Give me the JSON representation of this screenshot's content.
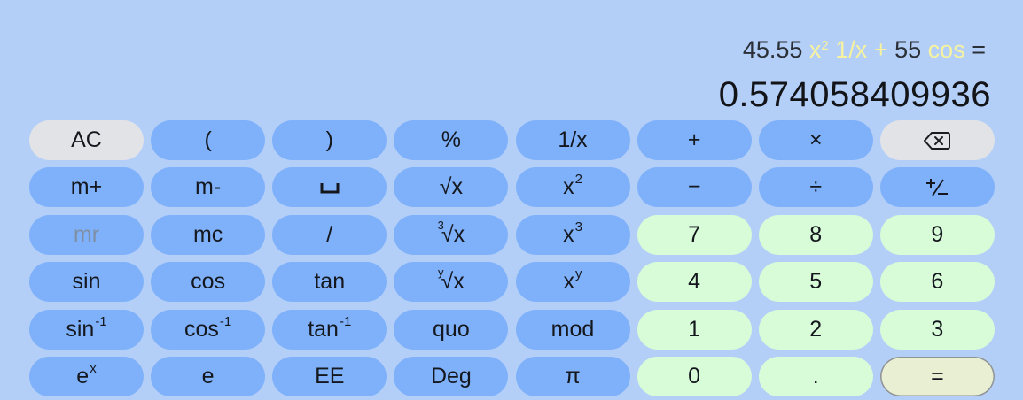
{
  "display": {
    "expression": {
      "p1": "45.55",
      "p2": "x",
      "p3": "2",
      "p4": "1/x",
      "p5": "+",
      "p6": "55",
      "p7": "cos",
      "p8": "="
    },
    "result": "0.574058409936"
  },
  "colors": {
    "background": "#b3cff8",
    "function_key": "#7fb1fa",
    "number_key": "#d8fbd8",
    "clear_key": "#e2e3e6",
    "equals_key": "#e9efd2",
    "expression_highlight": "#f6f2a0"
  },
  "keys": {
    "row1": {
      "ac": "AC",
      "lparen": "(",
      "rparen": ")",
      "percent": "%",
      "recip": "1/x",
      "add": "+",
      "mul": "×",
      "backspace_icon": "backspace-icon"
    },
    "row2": {
      "mplus": "m+",
      "mminus": "m-",
      "space": "␣",
      "sqrt": "√x",
      "sq_base": "x",
      "sq_exp": "2",
      "sub": "−",
      "div": "÷",
      "sign": "+/−"
    },
    "row3": {
      "mr": "mr",
      "mc": "mc",
      "slash": "/",
      "cbrt_idx": "3",
      "cbrt": "√x",
      "cube_base": "x",
      "cube_exp": "3",
      "n7": "7",
      "n8": "8",
      "n9": "9"
    },
    "row4": {
      "sin": "sin",
      "cos": "cos",
      "tan": "tan",
      "yroot_idx": "y",
      "yroot": "√x",
      "pow_base": "x",
      "pow_exp": "y",
      "n4": "4",
      "n5": "5",
      "n6": "6"
    },
    "row5": {
      "asin_base": "sin",
      "asin_exp": "-1",
      "acos_base": "cos",
      "acos_exp": "-1",
      "atan_base": "tan",
      "atan_exp": "-1",
      "quo": "quo",
      "mod": "mod",
      "n1": "1",
      "n2": "2",
      "n3": "3"
    },
    "row6": {
      "exp_base": "e",
      "exp_exp": "x",
      "e": "e",
      "ee": "EE",
      "deg": "Deg",
      "pi": "π",
      "n0": "0",
      "dot": ".",
      "equals": "="
    }
  }
}
